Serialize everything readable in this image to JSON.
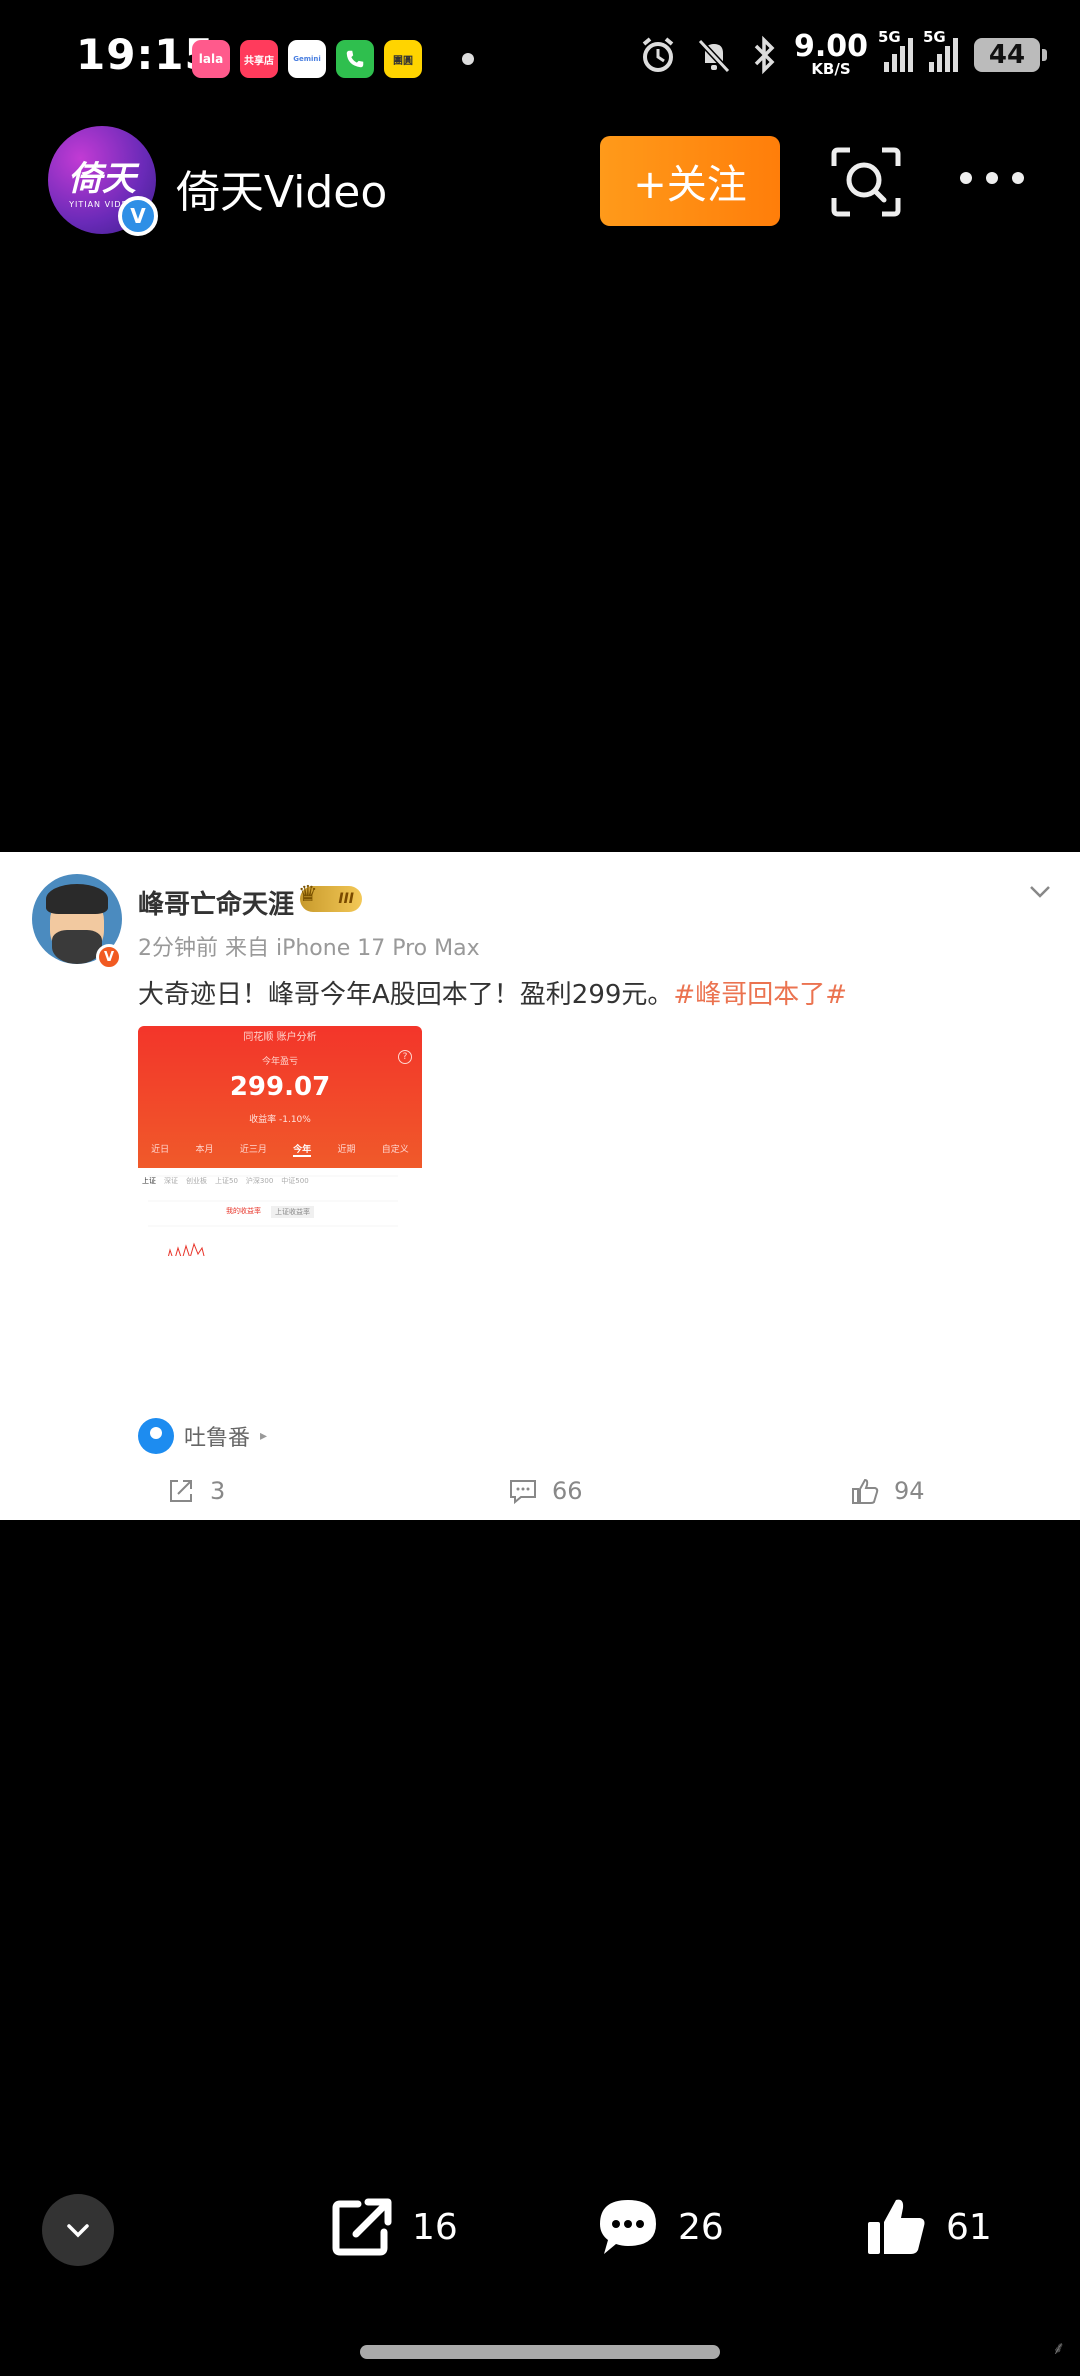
{
  "status_bar": {
    "time": "19:15",
    "app_badges": [
      {
        "label": "lala",
        "color": "#ff5a8c"
      },
      {
        "label": "共享店",
        "color": "#ff3b5c"
      },
      {
        "label": "Gemini",
        "color": "#ffffff"
      },
      {
        "label": "phone",
        "color": "#2fbf4e"
      },
      {
        "label": "團圓",
        "color": "#ffd400"
      }
    ],
    "net_speed_value": "9.00",
    "net_speed_unit": "KB/S",
    "network_1": "5G",
    "network_2": "5G",
    "battery": "44"
  },
  "header": {
    "channel_logo": "倚天",
    "channel_logo_sub": "YITIAN VIDEO",
    "verify_mark": "V",
    "channel_name": "倚天Video",
    "follow_label": "+关注"
  },
  "post": {
    "user_name": "峰哥亡命天涯",
    "vip_level": "III",
    "user_badge": "V",
    "meta": "2分钟前  来自 iPhone 17 Pro Max",
    "text": "大奇迹日！峰哥今年A股回本了！盈利299元。",
    "hashtag": "#峰哥回本了#",
    "image": {
      "nav_title": "同花顺 账户分析",
      "label": "今年盈亏",
      "value": "299.07",
      "rate": "收益率 -1.10%",
      "tabs": [
        "近日",
        "本月",
        "近三月",
        "今年",
        "近期",
        "自定义"
      ],
      "active_tab": "今年",
      "indices": [
        "上证",
        "深证",
        "创业板",
        "上证50",
        "沪深300",
        "中证500"
      ],
      "legend_a": "我的收益率",
      "legend_b": "上证收益率"
    },
    "location": "吐鲁番",
    "location_arrow": "▸",
    "shares": "3",
    "comments": "66",
    "likes": "94"
  },
  "bottom_bar": {
    "shares": "16",
    "comments": "26",
    "likes": "61"
  }
}
